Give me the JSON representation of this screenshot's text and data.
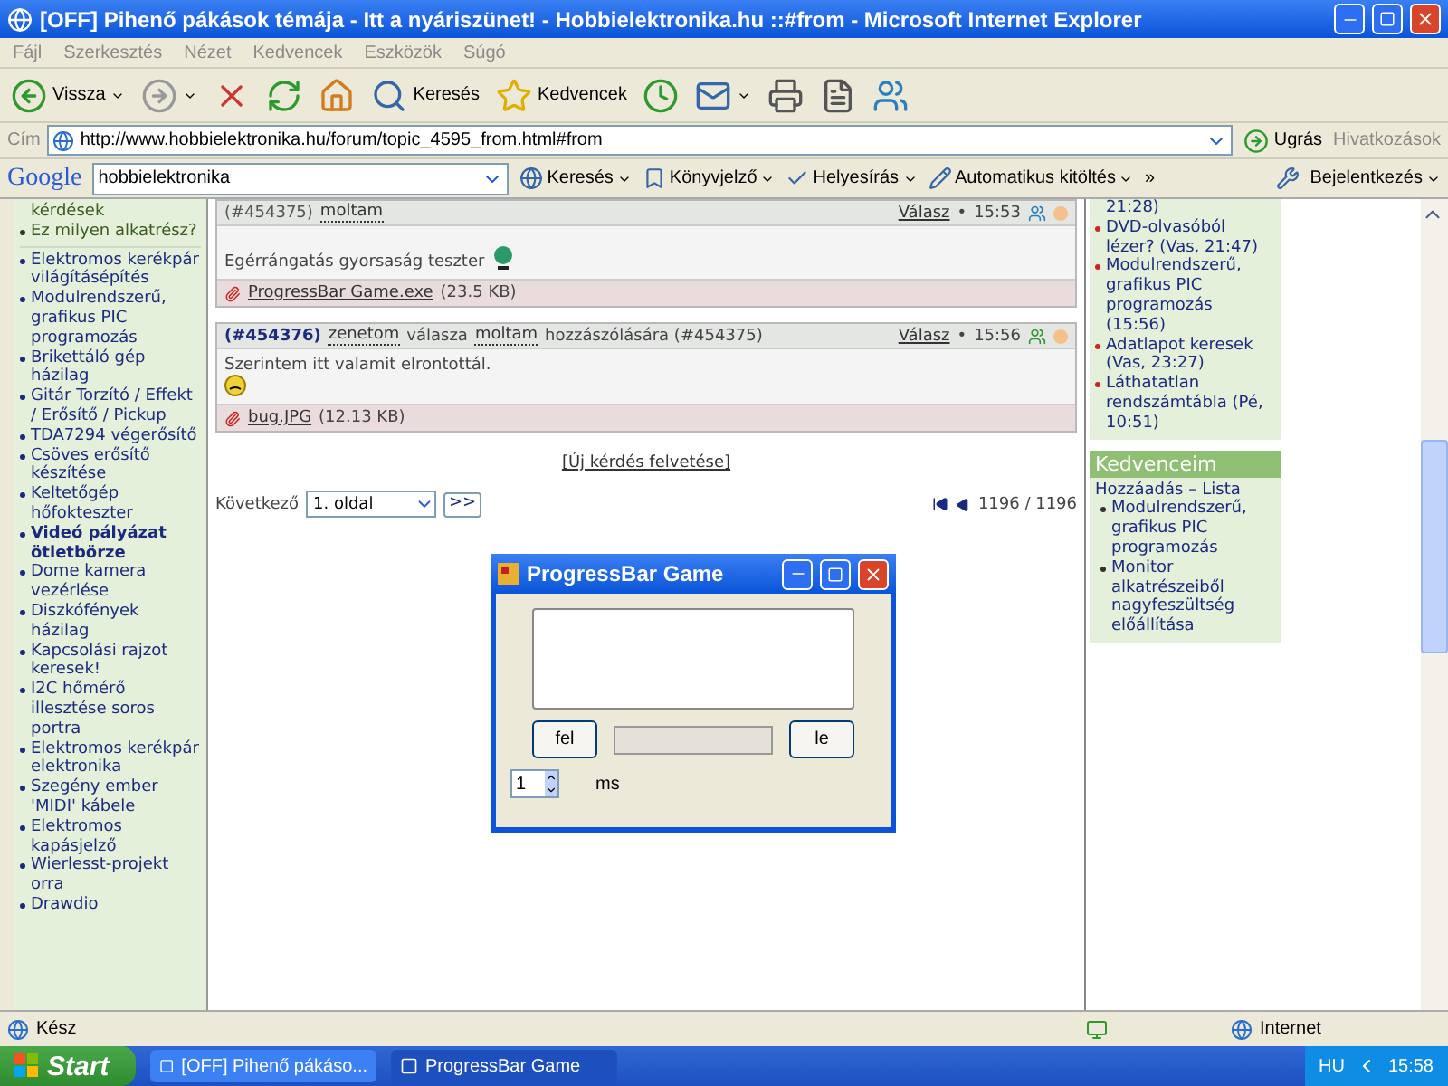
{
  "window": {
    "title": "[OFF] Pihenő pákások témája - Itt a nyáriszünet! - Hobbielektronika.hu ::#from - Microsoft Internet Explorer"
  },
  "menu": [
    "Fájl",
    "Szerkesztés",
    "Nézet",
    "Kedvencek",
    "Eszközök",
    "Súgó"
  ],
  "toolbar": [
    {
      "kind": "back",
      "label": "Vissza",
      "dropdown": true
    },
    {
      "kind": "forward",
      "dropdown": true
    },
    {
      "kind": "stop",
      "dropdown": false
    },
    {
      "kind": "refresh",
      "dropdown": false
    },
    {
      "kind": "home",
      "dropdown": false
    },
    {
      "kind": "search",
      "label": "Keresés",
      "dropdown": false
    },
    {
      "kind": "favorites",
      "label": "Kedvencek",
      "dropdown": false
    },
    {
      "kind": "history",
      "dropdown": false
    },
    {
      "kind": "mail",
      "dropdown": true
    },
    {
      "kind": "print",
      "dropdown": false
    },
    {
      "kind": "edit",
      "dropdown": false
    },
    {
      "kind": "messenger",
      "dropdown": false
    }
  ],
  "address": {
    "label": "Cím",
    "url": "http://www.hobbielektronika.hu/forum/topic_4595_from.html#from",
    "go": "Ugrás",
    "links": "Hivatkozások"
  },
  "google_bar": {
    "logo": "Google",
    "query": "hobbielektronika",
    "items": [
      {
        "label": "Keresés",
        "dropdown": true
      },
      {
        "label": "Könyvjelző",
        "dropdown": true
      },
      {
        "label": "Helyesírás",
        "dropdown": true
      },
      {
        "label": "Automatikus kitöltés",
        "dropdown": true
      },
      {
        "label": "»",
        "dropdown": false
      }
    ],
    "signin": "Bejelentkezés"
  },
  "left_sidebar": {
    "top": [
      "kérdések",
      "Ez milyen alkatrész?"
    ],
    "items": [
      {
        "text": "Elektromos kerékpár világításépítés",
        "bold": false
      },
      {
        "text": "Modulrendszerű, grafikus PIC programozás",
        "bold": false
      },
      {
        "text": "Brikettáló gép házilag",
        "bold": false
      },
      {
        "text": "Gitár Torzító / Effekt / Erősítő / Pickup",
        "bold": false
      },
      {
        "text": "TDA7294 végerősítő",
        "bold": false
      },
      {
        "text": "Csöves erősítő készítése",
        "bold": false
      },
      {
        "text": "Keltetőgép hőfokteszter",
        "bold": false
      },
      {
        "text": "Videó pályázat ötletbörze",
        "bold": true
      },
      {
        "text": "Dome kamera vezérlése",
        "bold": false
      },
      {
        "text": "Diszkófények házilag",
        "bold": false
      },
      {
        "text": "Kapcsolási rajzot keresek!",
        "bold": false
      },
      {
        "text": "I2C hőmérő illesztése soros portra",
        "bold": false
      },
      {
        "text": "Elektromos kerékpár elektronika",
        "bold": false
      },
      {
        "text": "Szegény ember 'MIDI' kábele",
        "bold": false
      },
      {
        "text": "Elektromos kapásjelző",
        "bold": false
      },
      {
        "text": "Wierlesst-projekt orra",
        "bold": false
      },
      {
        "text": "Drawdio",
        "bold": false
      }
    ]
  },
  "posts": [
    {
      "id": "(#454375)",
      "author": "moltam",
      "reply": "Válasz",
      "sep": "•",
      "time": "15:53",
      "body": "Egérrángatás gyorsaság teszter",
      "attachment": "ProgressBar Game.exe",
      "size": "(23.5 KB)",
      "highlight": false
    },
    {
      "id": "(#454376)",
      "author": "zenetom",
      "verb": "válasza",
      "target": "moltam",
      "suffix": "hozzászólására (#454375)",
      "reply": "Válasz",
      "sep": "•",
      "time": "15:56",
      "body": "Szerintem itt valamit elrontottál.",
      "attachment": "bug.JPG",
      "size": "(12.13 KB)",
      "highlight": true
    }
  ],
  "new_question": "[Új kérdés felvetése]",
  "pager": {
    "label": "Következő",
    "page": "1. oldal",
    "go": ">>",
    "count": "1196 / 1196"
  },
  "right_sidebar": {
    "top": "21:28)",
    "items": [
      "DVD-olvasóból lézer? (Vas, 21:47)",
      "Modulrendszerű, grafikus PIC programozás (15:56)",
      "Adatlapot keresek (Vas, 23:27)",
      "Láthatatlan rendszámtábla (Pé, 10:51)"
    ],
    "favorites": {
      "title": "Kedvenceim",
      "add": "Hozzáadás",
      "sep": "–",
      "list": "Lista",
      "items": [
        "Modulrendszerű, grafikus PIC programozás",
        "Monitor alkatrészeiből nagyfeszültség előállítása"
      ]
    }
  },
  "dialog": {
    "title": "ProgressBar Game",
    "up": "fel",
    "down": "le",
    "progress": {
      "level": 0
    },
    "spin": "1",
    "unit": "ms"
  },
  "status_bar": {
    "text": "Kész",
    "zone": "Internet"
  },
  "taskbar": {
    "start": "Start",
    "tasks": [
      {
        "label": "[OFF] Pihenő pákáso...",
        "selected": false
      },
      {
        "label": "ProgressBar Game",
        "selected": true
      }
    ],
    "lang": "HU",
    "clock": "15:58"
  }
}
